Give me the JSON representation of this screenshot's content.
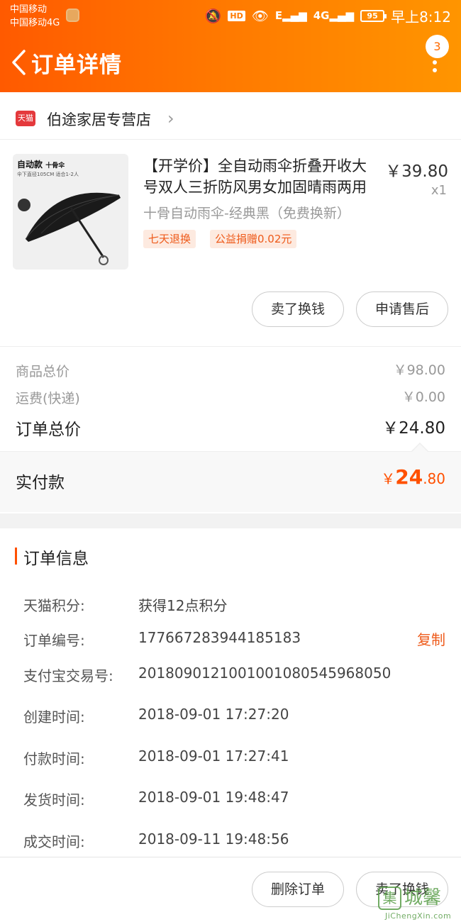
{
  "status_bar": {
    "carrier1": "中国移动",
    "carrier2": "中国移动4G",
    "hd": "HD",
    "signal1": "E",
    "signal2": "4G",
    "battery": "95",
    "time": "早上8:12"
  },
  "header": {
    "title": "订单详情",
    "menu_badge": "3"
  },
  "shop": {
    "logo_text": "天猫",
    "name": "伯途家居专营店"
  },
  "product": {
    "image_label": "自动款",
    "image_label_small": "十骨伞",
    "image_sub": "伞下直径105CM 适合1-2人",
    "title": "【开学价】全自动雨伞折叠开收大号双人三折防风男女加固晴雨两用",
    "price": "￥39.80",
    "qty": "x1",
    "sku": "十骨自动雨伞-经典黑（免费换新）",
    "tags": [
      "七天退换",
      "公益捐赠0.02元"
    ]
  },
  "item_actions": {
    "sell": "卖了换钱",
    "after_sale": "申请售后"
  },
  "summary": {
    "goods_label": "商品总价",
    "goods_value": "￥98.00",
    "shipping_label": "运费(快递)",
    "shipping_value": "￥0.00",
    "total_label": "订单总价",
    "total_value": "￥24.80",
    "paid_label": "实付款",
    "paid_currency": "￥",
    "paid_int": "24",
    "paid_dec": ".80"
  },
  "order_info": {
    "title": "订单信息",
    "rows": [
      {
        "label": "天猫积分:",
        "value": "获得12点积分"
      },
      {
        "label": "订单编号:",
        "value": "177667283944185183"
      },
      {
        "label": "支付宝交易号:",
        "value": "2018090121001001080545968050"
      },
      {
        "label": "创建时间:",
        "value": "2018-09-01 17:27:20"
      },
      {
        "label": "付款时间:",
        "value": "2018-09-01 17:27:41"
      },
      {
        "label": "发货时间:",
        "value": "2018-09-01 19:48:47"
      },
      {
        "label": "成交时间:",
        "value": "2018-09-11 19:48:56"
      }
    ],
    "copy": "复制"
  },
  "footer": {
    "delete": "删除订单",
    "sell": "卖了换钱"
  },
  "watermark": {
    "box": "集",
    "text": "城馨",
    "sub": "JiChengXin.com"
  },
  "colors": {
    "header_start": "#ff5a00",
    "header_end": "#ff9500",
    "accent": "#ff5000"
  }
}
